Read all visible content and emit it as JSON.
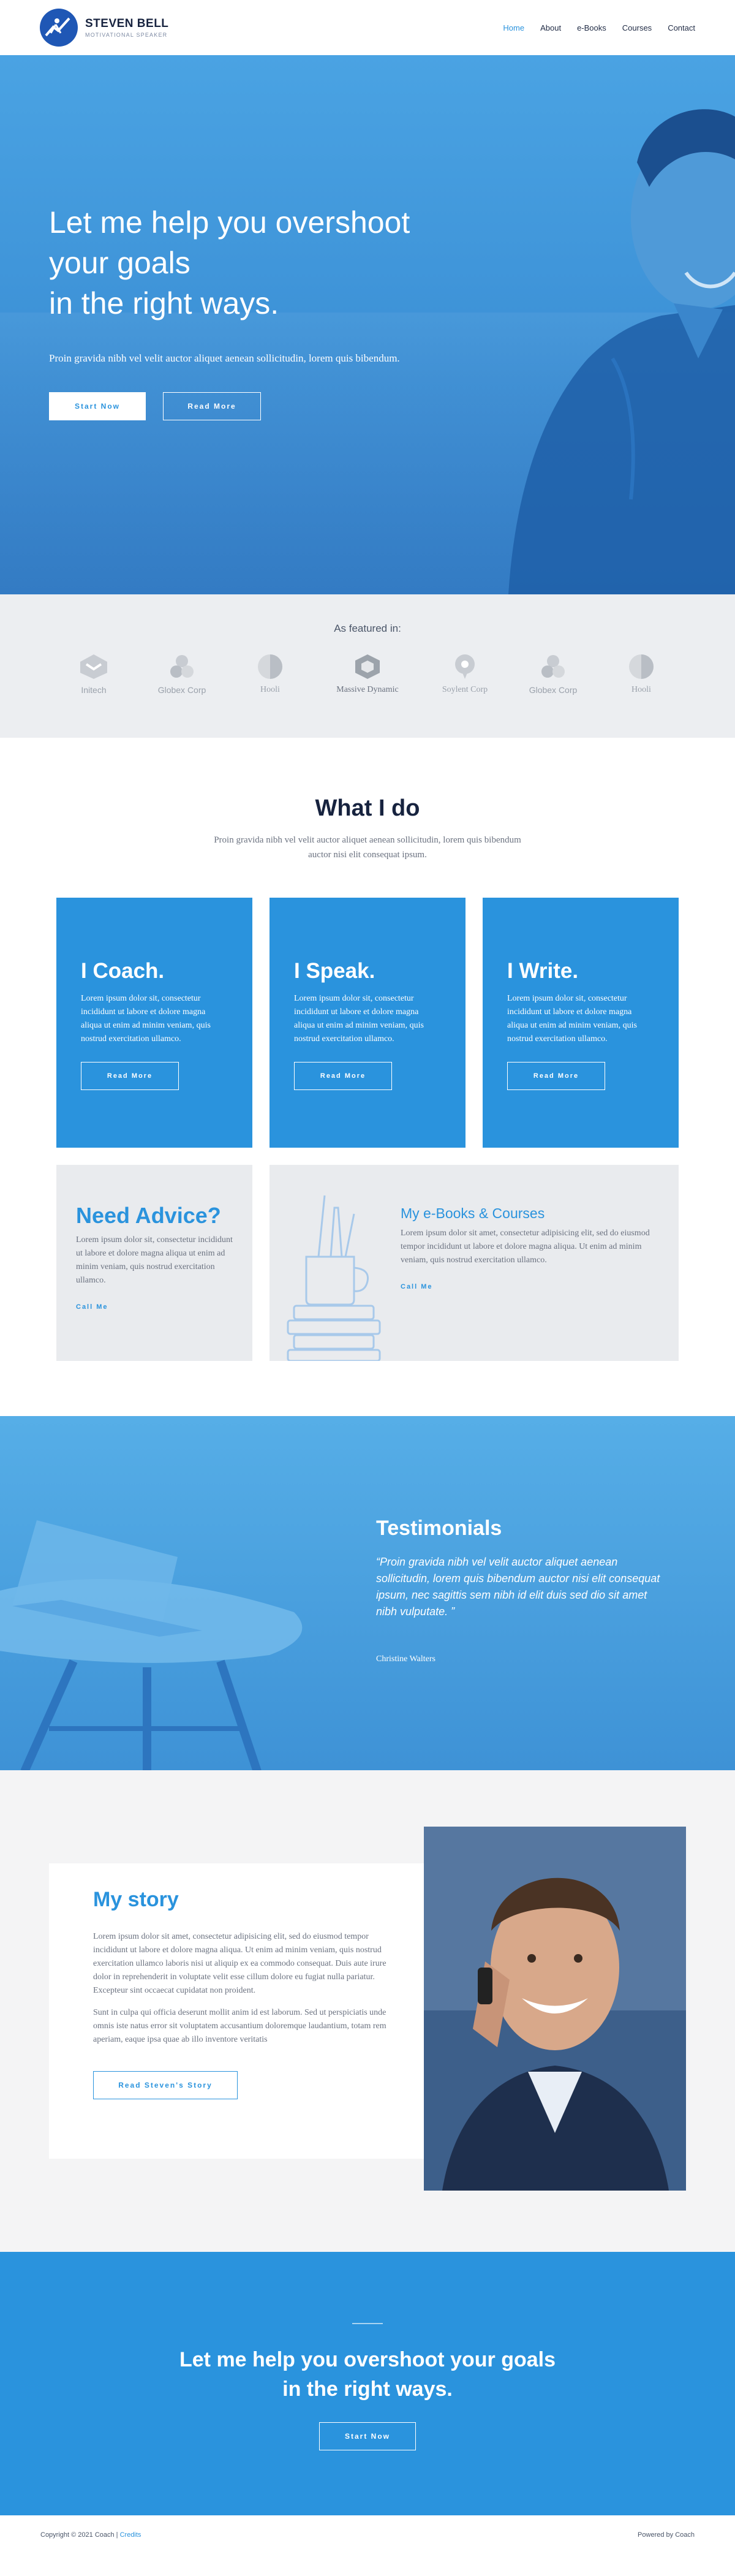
{
  "brand": {
    "name": "STEVEN BELL",
    "tagline": "MOTIVATIONAL SPEAKER"
  },
  "nav": {
    "items": [
      {
        "label": "Home"
      },
      {
        "label": "About"
      },
      {
        "label": "e-Books"
      },
      {
        "label": "Courses"
      },
      {
        "label": "Contact"
      }
    ]
  },
  "hero": {
    "title_line1": "Let me help you overshoot",
    "title_line2": "your goals",
    "title_line3": "in the right ways.",
    "subtitle": "Proin gravida nibh vel velit auctor aliquet aenean sollicitudin, lorem quis bibendum.",
    "btn_start": "Start Now",
    "btn_read": "Read More"
  },
  "featured": {
    "title": "As featured in:",
    "logos": [
      {
        "name": "Initech"
      },
      {
        "name": "Globex Corp"
      },
      {
        "name": "Hooli"
      },
      {
        "name": "Massive Dynamic"
      },
      {
        "name": "Soylent Corp"
      },
      {
        "name": "Globex Corp"
      },
      {
        "name": "Hooli"
      }
    ]
  },
  "whatido": {
    "title": "What I do",
    "subtitle": "Proin gravida nibh vel velit auctor aliquet aenean sollicitudin, lorem quis bibendum auctor nisi elit consequat ipsum.",
    "cards": [
      {
        "title": "I Coach.",
        "text": "Lorem ipsum dolor sit, consectetur incididunt ut labore et dolore magna aliqua ut enim ad minim veniam, quis nostrud exercitation ullamco.",
        "button": "Read More"
      },
      {
        "title": "I Speak.",
        "text": "Lorem ipsum dolor sit, consectetur incididunt ut labore et dolore magna aliqua ut enim ad minim veniam, quis nostrud exercitation ullamco.",
        "button": "Read More"
      },
      {
        "title": "I Write.",
        "text": "Lorem ipsum dolor sit, consectetur incididunt ut labore et dolore magna aliqua ut enim ad minim veniam, quis nostrud exercitation ullamco.",
        "button": "Read More"
      }
    ],
    "advice": {
      "title": "Need Advice?",
      "text": "Lorem ipsum dolor sit, consectetur incididunt ut labore et dolore magna aliqua ut enim ad minim veniam, quis nostrud exercitation ullamco.",
      "link": "Call Me"
    },
    "ebooks": {
      "title": "My e-Books & Courses",
      "text": "Lorem ipsum dolor sit amet, consectetur adipisicing elit, sed do eiusmod tempor incididunt ut labore et dolore magna aliqua. Ut enim ad minim veniam, quis nostrud exercitation ullamco.",
      "link": "Call Me"
    }
  },
  "testimonials": {
    "title": "Testimonials",
    "quote": "“Proin gravida nibh vel velit auctor aliquet aenean sollicitudin, lorem quis bibendum auctor nisi elit consequat ipsum, nec sagittis sem nibh id elit duis sed dio sit amet nibh vulputate. ”",
    "author": "Christine Walters"
  },
  "story": {
    "title": "My story",
    "para1": "Lorem ipsum dolor sit amet, consectetur adipisicing elit, sed do eiusmod tempor incididunt ut labore et dolore magna aliqua. Ut enim ad minim veniam, quis nostrud exercitation ullamco laboris nisi ut aliquip ex ea commodo consequat. Duis aute irure dolor in reprehenderit in voluptate velit esse cillum dolore eu fugiat nulla pariatur. Excepteur sint occaecat cupidatat non proident.",
    "para2": "Sunt in culpa qui officia deserunt mollit anim id est laborum. Sed ut perspiciatis unde omnis iste natus error sit voluptatem accusantium doloremque laudantium, totam rem aperiam, eaque ipsa quae ab illo inventore veritatis",
    "button": "Read Steven's Story"
  },
  "cta": {
    "title_line1": "Let me help you overshoot your goals",
    "title_line2": "in the right ways.",
    "button": "Start Now"
  },
  "footer": {
    "copyright": "Copyright © 2021 Coach | ",
    "credits": "Credits",
    "powered": "Powered by Coach"
  },
  "colors": {
    "accent": "#2a93dd",
    "navy": "#17233f",
    "grey_bg": "#eceef1"
  }
}
